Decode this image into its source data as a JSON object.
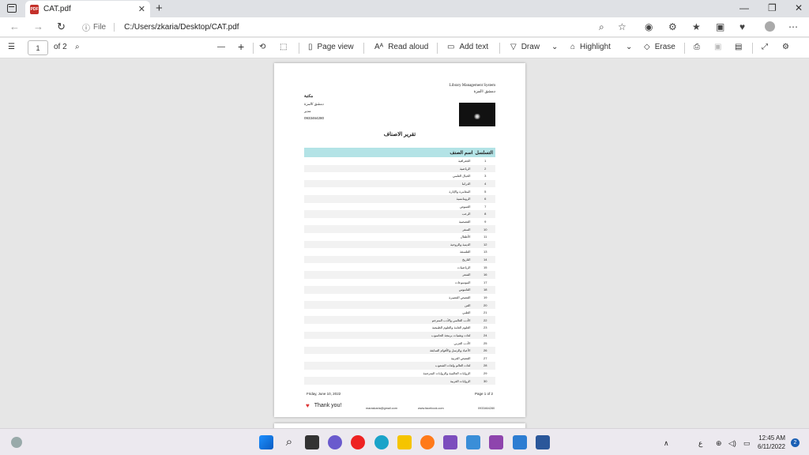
{
  "browser": {
    "tab_title": "CAT.pdf",
    "address_label": "File",
    "url": "C:/Users/zkaria/Desktop/CAT.pdf"
  },
  "pdf_toolbar": {
    "page_number": "1",
    "page_total": "of 2",
    "page_view": "Page view",
    "read_aloud": "Read aloud",
    "add_text": "Add text",
    "draw": "Draw",
    "highlight": "Highlight",
    "erase": "Erase"
  },
  "document": {
    "org_name": "Library Management System",
    "org_city": "دمشق /المزة",
    "left_name": "مكتبة",
    "left_city": "دمشق /المزة",
    "left_note": "مدير",
    "left_phone": "0933464280",
    "report_title": "تقرير الاصناف",
    "table_headers": {
      "serial": "التسلسل",
      "name": "اسم الصنف"
    },
    "rows": [
      {
        "n": "1",
        "name": "الجغرافية"
      },
      {
        "n": "2",
        "name": "الرياضية"
      },
      {
        "n": "3",
        "name": "الخيال العلمي"
      },
      {
        "n": "4",
        "name": "الدراما"
      },
      {
        "n": "5",
        "name": "المغامرة والإثارة"
      },
      {
        "n": "6",
        "name": "الرومانسية"
      },
      {
        "n": "7",
        "name": "الغموض"
      },
      {
        "n": "8",
        "name": "الرعب"
      },
      {
        "n": "9",
        "name": "القصصية"
      },
      {
        "n": "10",
        "name": "السفر"
      },
      {
        "n": "11",
        "name": "الأطفال"
      },
      {
        "n": "12",
        "name": "الدينية والروحية"
      },
      {
        "n": "13",
        "name": "الفلسفة"
      },
      {
        "n": "14",
        "name": "التاريخ"
      },
      {
        "n": "15",
        "name": "الرياضيات"
      },
      {
        "n": "16",
        "name": "الشعر"
      },
      {
        "n": "17",
        "name": "الموسوعات"
      },
      {
        "n": "18",
        "name": "القاموس"
      },
      {
        "n": "19",
        "name": "القصص القصيرة"
      },
      {
        "n": "20",
        "name": "الفن"
      },
      {
        "n": "21",
        "name": "الطبي"
      },
      {
        "n": "22",
        "name": "الأدب العالمي والأدب المترجم"
      },
      {
        "n": "23",
        "name": "العلوم العامة والعلوم الطبيعية"
      },
      {
        "n": "24",
        "name": "لغات وتقنيات برمجة الحاسوب"
      },
      {
        "n": "25",
        "name": "الأدب العربي"
      },
      {
        "n": "26",
        "name": "الأعياد والرسل والأقوام السابقة"
      },
      {
        "n": "27",
        "name": "القصص الغربية"
      },
      {
        "n": "28",
        "name": "لغات العالم ولغات الشعوب"
      },
      {
        "n": "29",
        "name": "الروايات العالمية والروايات المترجمة"
      },
      {
        "n": "30",
        "name": "الروايات الغربية"
      }
    ],
    "footer_date": "Friday, June 10, 2022",
    "footer_page": "Page 1 of 2",
    "thank_you": "Thank you!",
    "email": "maraskaria@gmail.com",
    "facebook": "www.facebook.com",
    "phone": "0933464280"
  },
  "taskbar": {
    "time": "12:45 AM",
    "date": "6/11/2022",
    "lang": "ع",
    "notif_count": "2"
  }
}
